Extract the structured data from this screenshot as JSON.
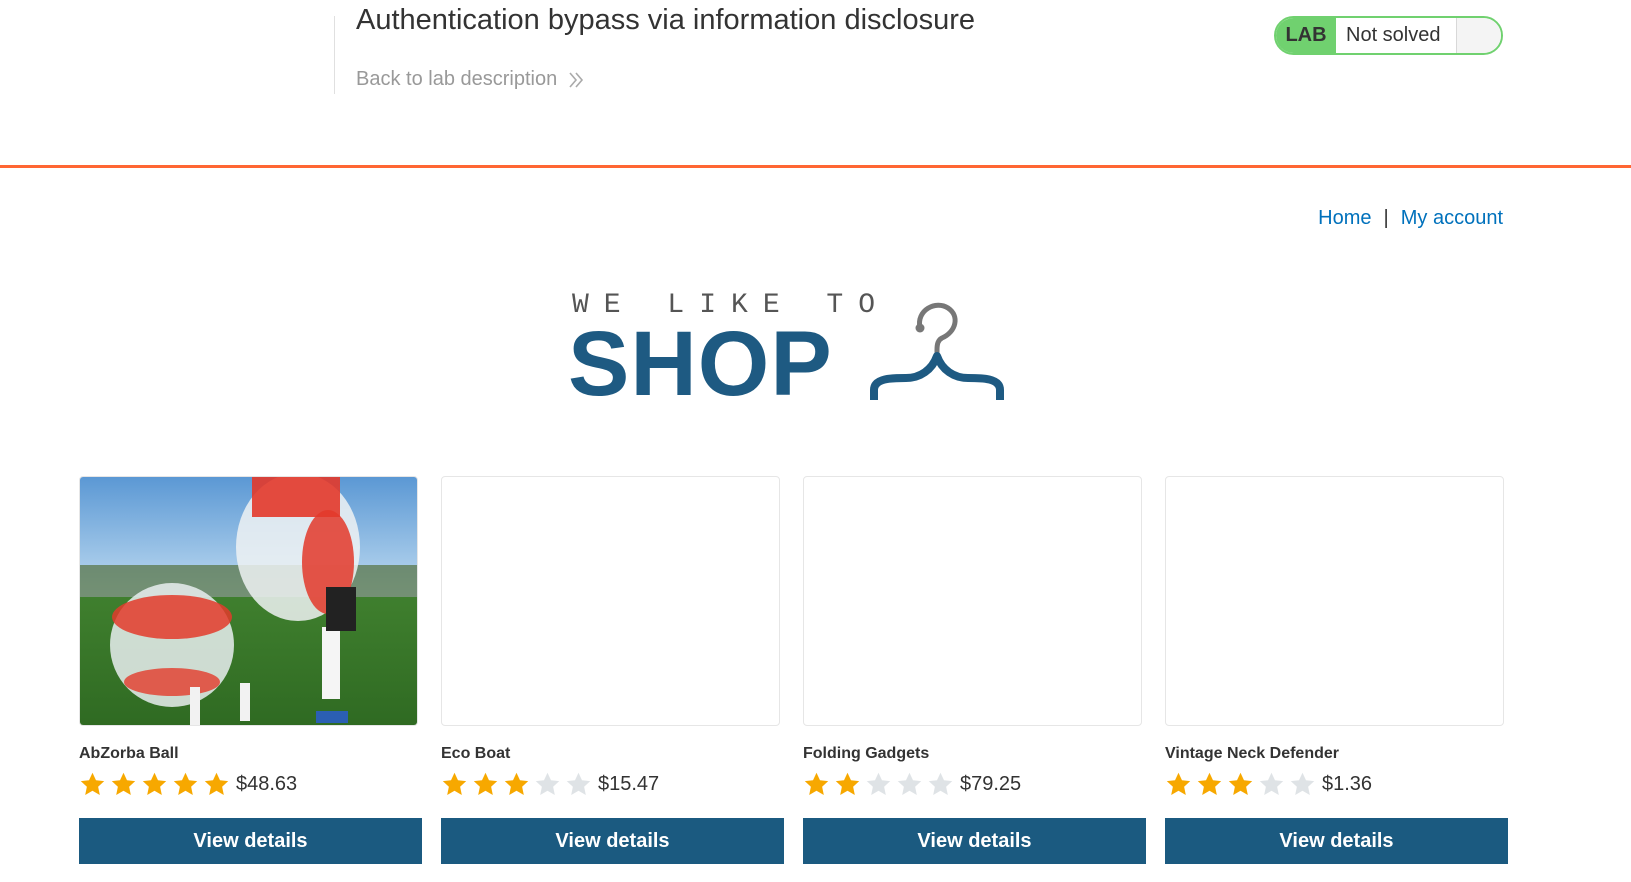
{
  "lab": {
    "title": "Authentication bypass via information disclosure",
    "back_link": "Back to lab description",
    "badge": "LAB",
    "status": "Not solved",
    "colors": {
      "badge_green": "#70d16f",
      "rule_orange": "#ff6633"
    }
  },
  "nav": {
    "home": "Home",
    "separator": "|",
    "account": "My account",
    "link_color": "#0071bc"
  },
  "logo": {
    "tagline": "WE LIKE TO",
    "word": "SHOP",
    "icon": "hanger-icon",
    "color": "#1e5a82"
  },
  "products": [
    {
      "name": "AbZorba Ball",
      "rating": 5,
      "max_rating": 5,
      "price": "$48.63",
      "button": "View details",
      "has_image": true
    },
    {
      "name": "Eco Boat",
      "rating": 3,
      "max_rating": 5,
      "price": "$15.47",
      "button": "View details",
      "has_image": false
    },
    {
      "name": "Folding Gadgets",
      "rating": 2,
      "max_rating": 5,
      "price": "$79.25",
      "button": "View details",
      "has_image": false
    },
    {
      "name": "Vintage Neck Defender",
      "rating": 3,
      "max_rating": 5,
      "price": "$1.36",
      "button": "View details",
      "has_image": false
    }
  ],
  "colors": {
    "star_filled": "#f7a800",
    "star_empty": "#dfe3e6",
    "button": "#1b5a80"
  }
}
